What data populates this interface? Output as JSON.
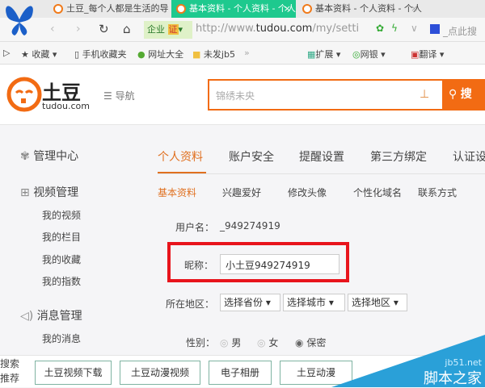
{
  "browser": {
    "tabs": [
      {
        "label": "土豆_每个人都是生活的导演"
      },
      {
        "label": "基本资料 - 个人资料 - 个人"
      },
      {
        "label": "基本资料 - 个人资料 - 个人"
      }
    ],
    "close": "×",
    "enterprise_badge": "企业",
    "cert_badge": "证",
    "url_prefix": "http://www.",
    "url_domain": "tudou.com",
    "url_path": "/my/setti",
    "search_placeholder": "_点此搜",
    "bookmarks": [
      "收藏",
      "手机收藏夹",
      "网址大全",
      "未发jb5",
      "»"
    ],
    "toolbar": [
      "扩展",
      "网银",
      "翻译"
    ]
  },
  "site": {
    "logo_text": "土豆",
    "logo_sub": "tudou.com",
    "nav": "☰ 导航",
    "search_placeholder": "锦绣未央",
    "search_button": "搜",
    "accent": "#f26b13"
  },
  "sidebar": {
    "sections": [
      {
        "title": "管理中心",
        "items": []
      },
      {
        "title": "视频管理",
        "items": [
          "我的视频",
          "我的栏目",
          "我的收藏",
          "我的指数"
        ]
      },
      {
        "title": "消息管理",
        "items": [
          "我的消息"
        ]
      }
    ]
  },
  "main": {
    "tabs": [
      "个人资料",
      "账户安全",
      "提醒设置",
      "第三方绑定",
      "认证设"
    ],
    "subtabs": [
      "基本资料",
      "兴趣爱好",
      "修改头像",
      "个性化域名",
      "联系方式"
    ],
    "username_label": "用户名：",
    "username": "_949274919",
    "nickname_label": "昵称：",
    "nickname": "小土豆949274919",
    "region_label": "所在地区：",
    "region_selects": [
      "选择省份",
      "选择城市",
      "选择地区"
    ],
    "gender_label": "性别：",
    "gender_options": [
      "男",
      "女",
      "保密"
    ],
    "gender_selected": "保密"
  },
  "footer": {
    "label": "搜索推荐",
    "buttons": [
      "土豆视频下载",
      "土豆动漫视频",
      "电子相册",
      "土豆动漫"
    ]
  },
  "watermark": {
    "line1": "jb51.net",
    "line2": "脚本之家"
  }
}
